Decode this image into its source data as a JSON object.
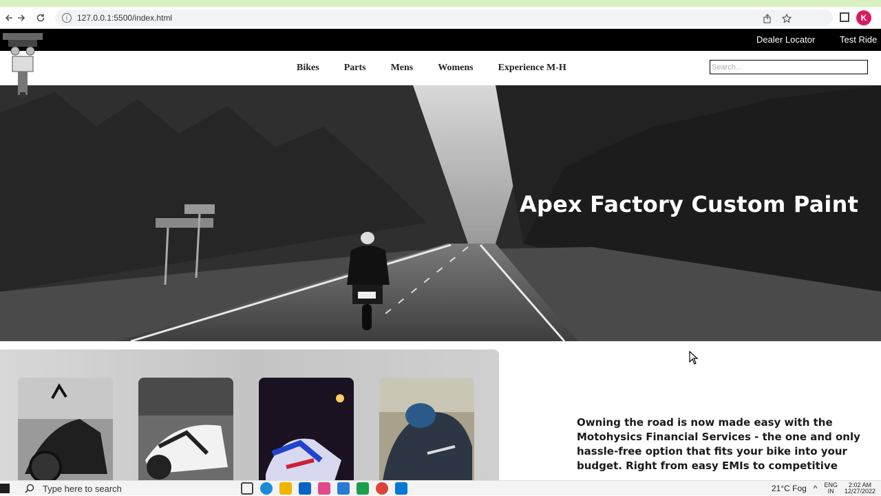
{
  "browser": {
    "url": "127.0.0.1:5500/index.html",
    "profile_initial": "K"
  },
  "topbar": {
    "dealer_locator": "Dealer Locator",
    "test_ride": "Test Ride"
  },
  "nav": {
    "items": [
      "Bikes",
      "Parts",
      "Mens",
      "Womens",
      "Experience M-H"
    ],
    "search_placeholder": "Search..."
  },
  "hero": {
    "title": "Apex Factory Custom Paint"
  },
  "finance": {
    "text": "Owning the road is now made easy with the Motohysics Financial Services - the one and only hassle-free option that fits your bike into your budget. Right from easy EMIs to competitive"
  },
  "taskbar": {
    "search_placeholder": "Type here to search",
    "weather": "21°C  Fog",
    "lang_top": "ENG",
    "lang_bottom": "IN",
    "time": "2:02 AM",
    "date": "12/27/2022"
  },
  "colors": {
    "topbar_bg": "#000000",
    "avatar": "#d81b60",
    "cards_panel": "#cccccc"
  }
}
